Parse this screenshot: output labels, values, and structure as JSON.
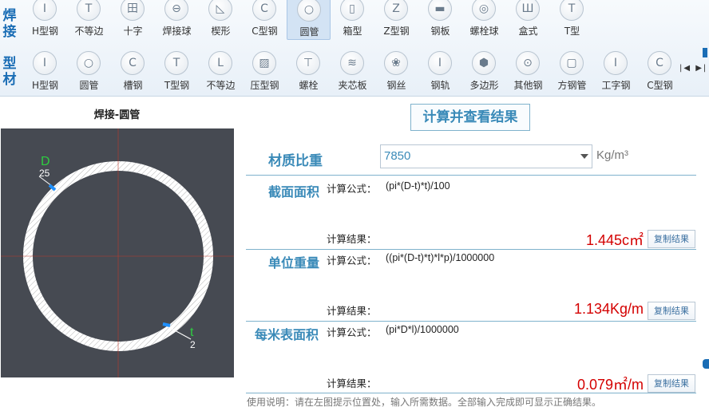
{
  "toolbar": {
    "row1_label": "焊接",
    "row2_label": "型材",
    "row1_items": [
      {
        "label": "H型钢",
        "icon": "h-beam-icon",
        "glyph": "I"
      },
      {
        "label": "不等边",
        "icon": "unequal-angle-icon",
        "glyph": "T"
      },
      {
        "label": "十字",
        "icon": "cross-section-icon",
        "glyph": "田"
      },
      {
        "label": "焊接球",
        "icon": "welded-ball-icon",
        "glyph": "⊖"
      },
      {
        "label": "楔形",
        "icon": "wedge-icon",
        "glyph": "◺"
      },
      {
        "label": "C型钢",
        "icon": "c-channel-icon",
        "glyph": "C"
      },
      {
        "label": "圆管",
        "icon": "round-tube-icon",
        "glyph": "○",
        "selected": true
      },
      {
        "label": "箱型",
        "icon": "box-section-icon",
        "glyph": "▯"
      },
      {
        "label": "Z型钢",
        "icon": "z-section-icon",
        "glyph": "Z"
      },
      {
        "label": "钢板",
        "icon": "steel-plate-icon",
        "glyph": "▬"
      },
      {
        "label": "螺栓球",
        "icon": "bolt-ball-icon",
        "glyph": "◎"
      },
      {
        "label": "盒式",
        "icon": "box-type-icon",
        "glyph": "Ш"
      },
      {
        "label": "T型",
        "icon": "t-section-icon",
        "glyph": "T"
      }
    ],
    "row2_items": [
      {
        "label": "H型钢",
        "icon": "h-beam-icon",
        "glyph": "I"
      },
      {
        "label": "圆管",
        "icon": "round-tube-icon",
        "glyph": "○"
      },
      {
        "label": "槽钢",
        "icon": "channel-steel-icon",
        "glyph": "C"
      },
      {
        "label": "T型钢",
        "icon": "t-steel-icon",
        "glyph": "T"
      },
      {
        "label": "不等边",
        "icon": "unequal-angle-icon",
        "glyph": "L"
      },
      {
        "label": "压型钢",
        "icon": "profiled-steel-icon",
        "glyph": "▨"
      },
      {
        "label": "螺栓",
        "icon": "bolt-icon",
        "glyph": "⊤"
      },
      {
        "label": "夹芯板",
        "icon": "sandwich-panel-icon",
        "glyph": "≋"
      },
      {
        "label": "钢丝",
        "icon": "steel-wire-icon",
        "glyph": "❀"
      },
      {
        "label": "钢轨",
        "icon": "rail-icon",
        "glyph": "I"
      },
      {
        "label": "多边形",
        "icon": "polygon-icon",
        "glyph": "⬢"
      },
      {
        "label": "其他钢",
        "icon": "other-steel-icon",
        "glyph": "⊙"
      },
      {
        "label": "方钢管",
        "icon": "square-tube-icon",
        "glyph": "▢"
      },
      {
        "label": "工字钢",
        "icon": "i-beam-icon",
        "glyph": "I"
      },
      {
        "label": "C型钢",
        "icon": "c-channel-icon",
        "glyph": "C"
      }
    ]
  },
  "figure": {
    "title": "焊接-圆管",
    "d_label": "D",
    "d_value": "25",
    "t_label": "t",
    "t_value": "2"
  },
  "main": {
    "calc_button": "计算并查看结果",
    "density_label": "材质比重",
    "density_value": "7850",
    "density_unit": "Kg/m³",
    "formula_label": "计算公式：",
    "result_label": "计算结果：",
    "copy_label": "复制结果",
    "sections": [
      {
        "title": "截面面积",
        "formula": "(pi*(D-t)*t)/100",
        "result": "1.445c㎡"
      },
      {
        "title": "单位重量",
        "formula": "((pi*(D-t)*t)*l*p)/1000000",
        "result": "1.134Kg/m"
      },
      {
        "title": "每米表面积",
        "formula": "(pi*D*l)/1000000",
        "result": "0.079㎡/m"
      }
    ],
    "usage_note": "使用说明：请在左图提示位置处，输入所需数据。全部输入完成即可显示正确结果。"
  },
  "colors": {
    "accent": "#3a8ab8",
    "result_red": "#d40000",
    "figure_bg": "#464a52",
    "dim_green": "#2ecc40",
    "dim_blue": "#1e90ff"
  }
}
